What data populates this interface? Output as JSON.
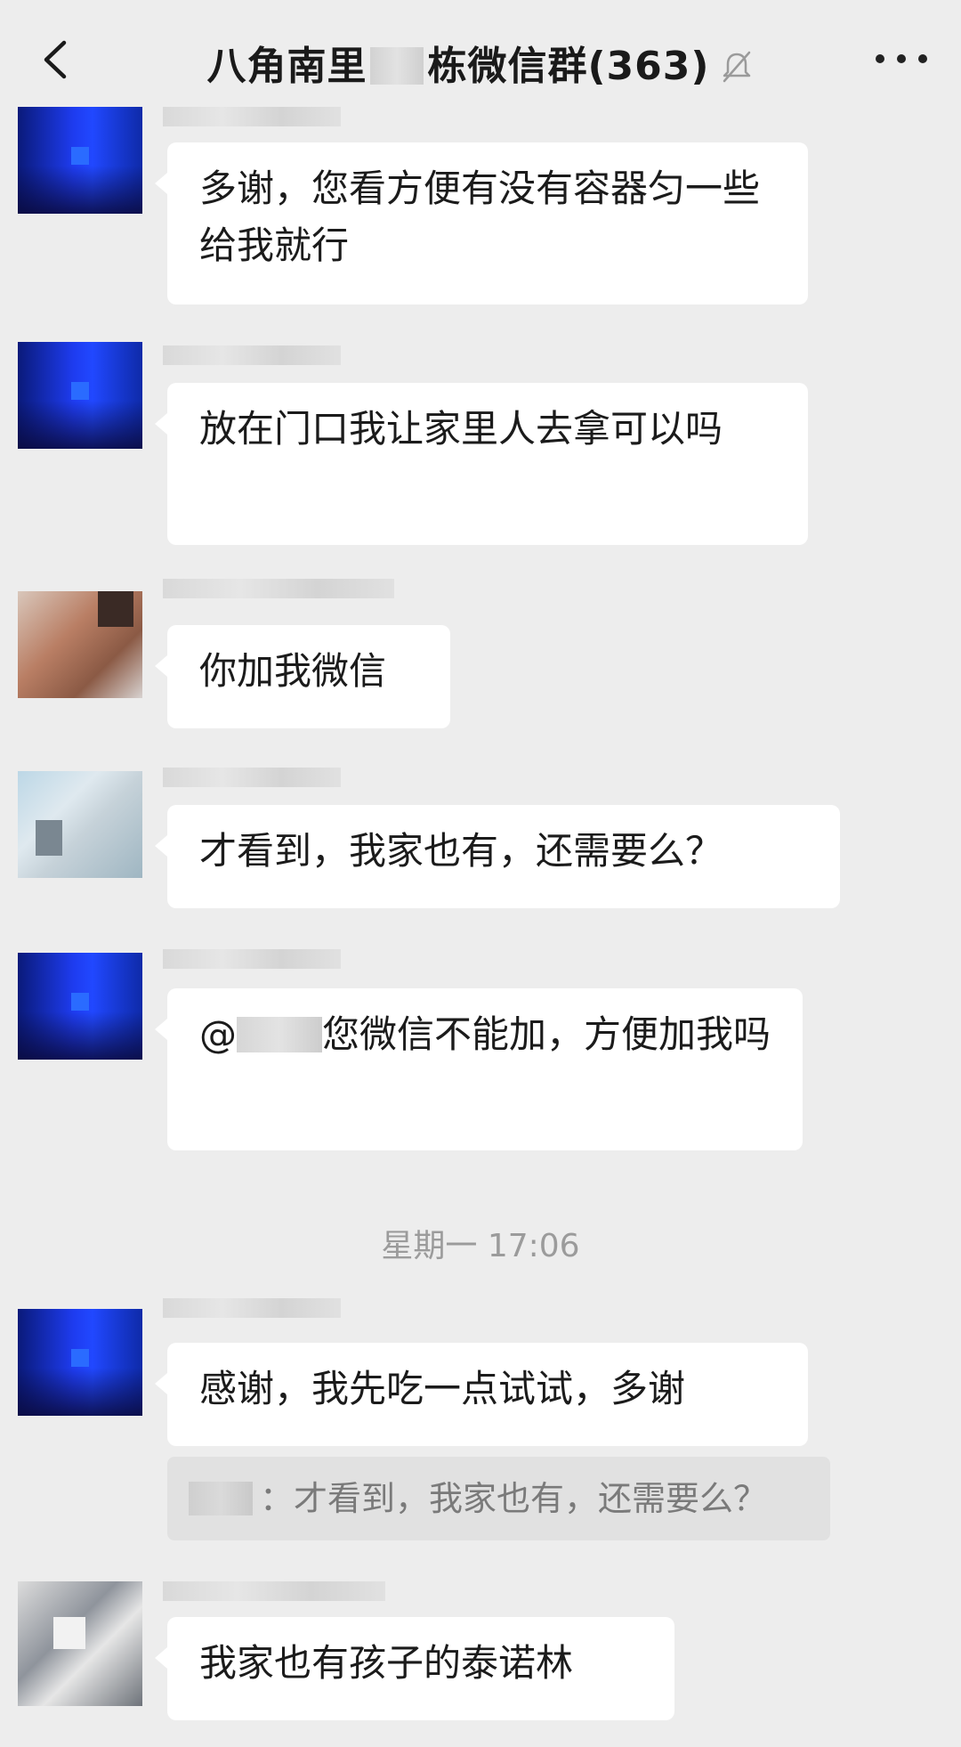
{
  "header": {
    "title_prefix": "八角南里",
    "title_suffix": "栋微信群(363)"
  },
  "messages": [
    {
      "text": "多谢，您看方便有没有容器匀一些给我就行"
    },
    {
      "text": "放在门口我让家里人去拿可以吗"
    },
    {
      "text": "你加我微信"
    },
    {
      "text": "才看到，我家也有，还需要么？"
    },
    {
      "mention_prefix": "@",
      "text": "您微信不能加，方便加我吗"
    },
    {
      "text": "感谢，我先吃一点试试，多谢"
    },
    {
      "text": "我家也有孩子的泰诺林"
    }
  ],
  "timestamp": "星期一 17:06",
  "quote": {
    "separator": "：",
    "text": "才看到，我家也有，还需要么？"
  }
}
